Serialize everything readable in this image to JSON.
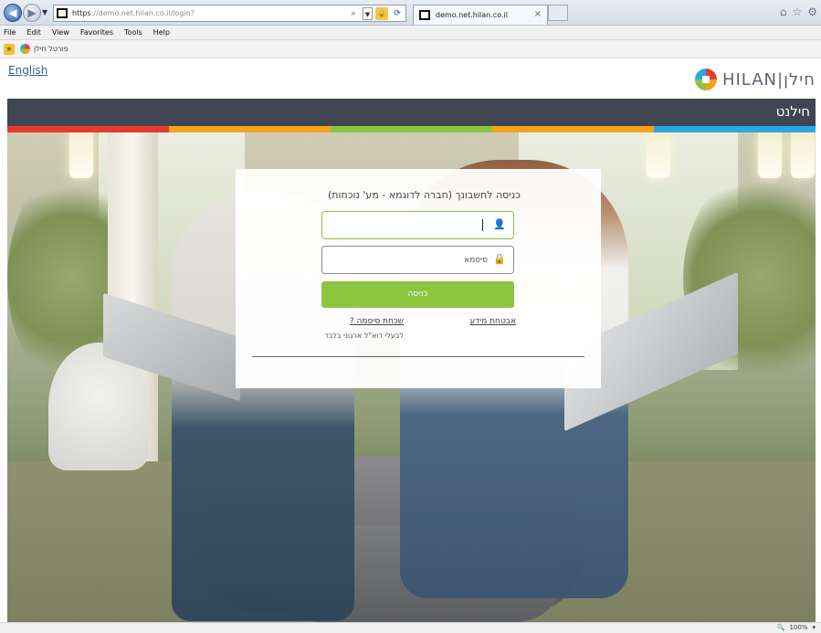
{
  "browser": {
    "url_protocol": "https",
    "url_rest": "://demo.net.hilan.co.il/login?",
    "tab_title": "demo.net.hilan.co.il",
    "tab_close": "×",
    "menu": [
      "File",
      "Edit",
      "View",
      "Favorites",
      "Tools",
      "Help"
    ],
    "favorites_item": "פורטל חילן",
    "zoom": "100%",
    "zoom_drop": "▾"
  },
  "header": {
    "language_link": "English",
    "brand_text": "HILAN|חילן",
    "title": "חילנט"
  },
  "strip_colors": [
    "#e8392e",
    "#f6a21d",
    "#8cc63f",
    "#f6a21d",
    "#2aa8e0"
  ],
  "login": {
    "heading": "כניסה לחשבונך (חברה לדוגמא - מע' נוכחות)",
    "username_value": "",
    "password_placeholder": "סיסמא",
    "submit_label": "כניסה",
    "security_link": "אבטחת מידע",
    "forgot_link": "שכחת סיסמה ?",
    "forgot_note": "לבעלי דוא\"ל ארגוני בלבד"
  },
  "colors": {
    "accent": "#8cc63f",
    "title_bar": "#3f4652"
  }
}
